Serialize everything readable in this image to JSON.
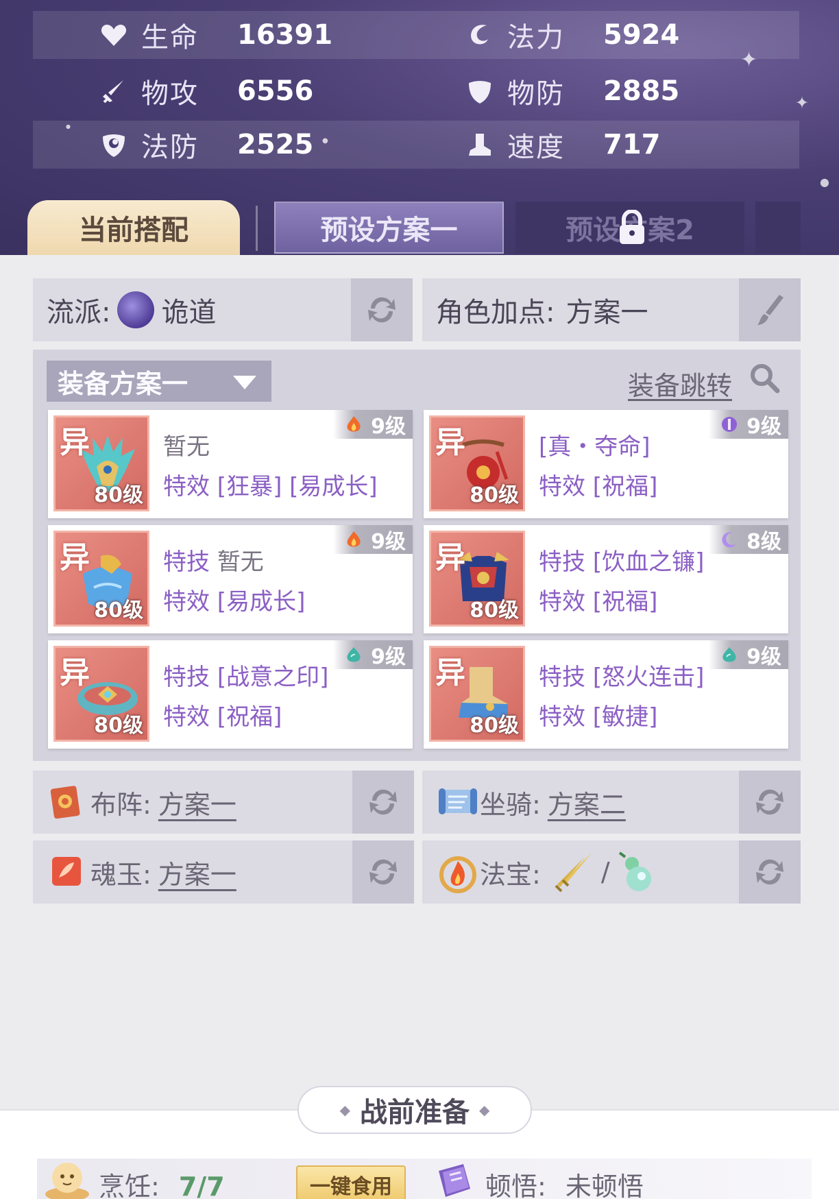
{
  "stats": [
    {
      "icon": "heart-icon",
      "label": "生命",
      "value": "16391"
    },
    {
      "icon": "swirl-icon",
      "label": "法力",
      "value": "5924"
    },
    {
      "icon": "sword-icon",
      "label": "物攻",
      "value": "6556"
    },
    {
      "icon": "shield-icon",
      "label": "物防",
      "value": "2885"
    },
    {
      "icon": "magic-shield-icon",
      "label": "法防",
      "value": "2525"
    },
    {
      "icon": "boot-icon",
      "label": "速度",
      "value": "717"
    }
  ],
  "tabs": {
    "current": "当前搭配",
    "preset1": "预设方案一",
    "preset2": "预设方案2"
  },
  "school": {
    "label": "流派:",
    "value": "诡道"
  },
  "attr_points": {
    "label": "角色加点:",
    "value": "方案一"
  },
  "equipment": {
    "plan": "装备方案一",
    "jump": "装备跳转",
    "items": [
      {
        "badge": "异",
        "level": "80级",
        "line1": "暂无",
        "line1_prefix": "",
        "line2": "特效 [狂暴] [易成长]",
        "grade": "9级",
        "gem": "fire"
      },
      {
        "badge": "异",
        "level": "80级",
        "line1": "[真・夺命]",
        "line1_prefix": "",
        "line2": "特效 [祝福]",
        "grade": "9级",
        "gem": "purple"
      },
      {
        "badge": "异",
        "level": "80级",
        "line1": "暂无",
        "line1_prefix": "特技",
        "line2": "特效 [易成长]",
        "grade": "9级",
        "gem": "fire"
      },
      {
        "badge": "异",
        "level": "80级",
        "line1": "[饮血之镰]",
        "line1_prefix": "特技",
        "line2": "特效 [祝福]",
        "grade": "8级",
        "gem": "moon"
      },
      {
        "badge": "异",
        "level": "80级",
        "line1": "[战意之印]",
        "line1_prefix": "特技",
        "line2": "特效 [祝福]",
        "grade": "9级",
        "gem": "water"
      },
      {
        "badge": "异",
        "level": "80级",
        "line1": "[怒火连击]",
        "line1_prefix": "特技",
        "line2": "特效 [敏捷]",
        "grade": "9级",
        "gem": "water"
      }
    ]
  },
  "formation": {
    "label": "布阵:",
    "value": "方案一"
  },
  "mount": {
    "label": "坐骑:",
    "value": "方案二"
  },
  "soul_jade": {
    "label": "魂玉:",
    "value": "方案一"
  },
  "treasure": {
    "label": "法宝:",
    "separator": "/"
  },
  "prep": {
    "title": "战前准备",
    "cooking_label": "烹饪:",
    "cooking_value": "7/7",
    "eat_button": "一键食用",
    "insight_label": "顿悟:",
    "insight_value": "未顿悟"
  },
  "colors": {
    "header_bg": "#4a3e73",
    "accent_purple": "#8b5fc4",
    "card_red": "#d26a62",
    "panel_grey": "#dcdbe3"
  }
}
